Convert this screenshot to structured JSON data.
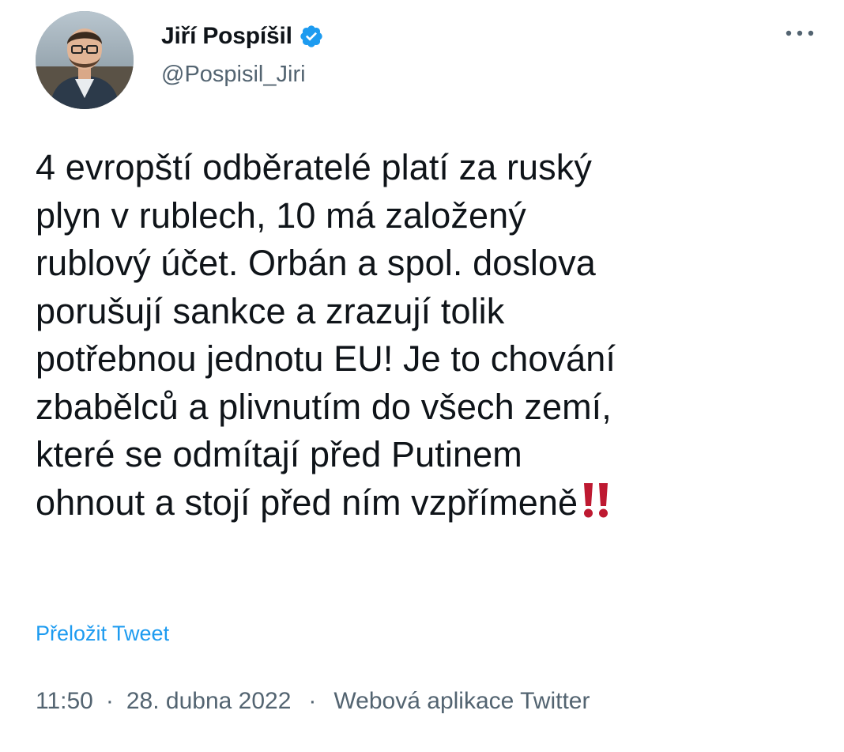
{
  "author": {
    "display_name": "Jiří Pospíšil",
    "handle": "@Pospisil_Jiri",
    "verified": true,
    "avatar_icon": "profile-photo"
  },
  "tweet": {
    "text": "4 evropští odběratelé platí za ruský\nplyn v rublech, 10 má založený\nrublový účet. Orbán a spol. doslova\nporušují sankce a zrazují tolik\npotřebnou jednotu EU! Je to chování\nzbabělců a plivnutím do všech zemí,\nkteré se odmítají před Putinem\nohnout a stojí před ním vzpřímeně",
    "trailing_emoji": "double-exclamation-icon",
    "translate_label": "Přeložit Tweet"
  },
  "meta": {
    "time": "11:50",
    "separator": "·",
    "date": "28. dubna 2022",
    "source": "Webová aplikace Twitter"
  },
  "colors": {
    "link": "#1d9bf0",
    "secondary_text": "#536471",
    "primary_text": "#0f1419",
    "verified": "#1d9bf0",
    "emoji_red": "#be1931"
  }
}
